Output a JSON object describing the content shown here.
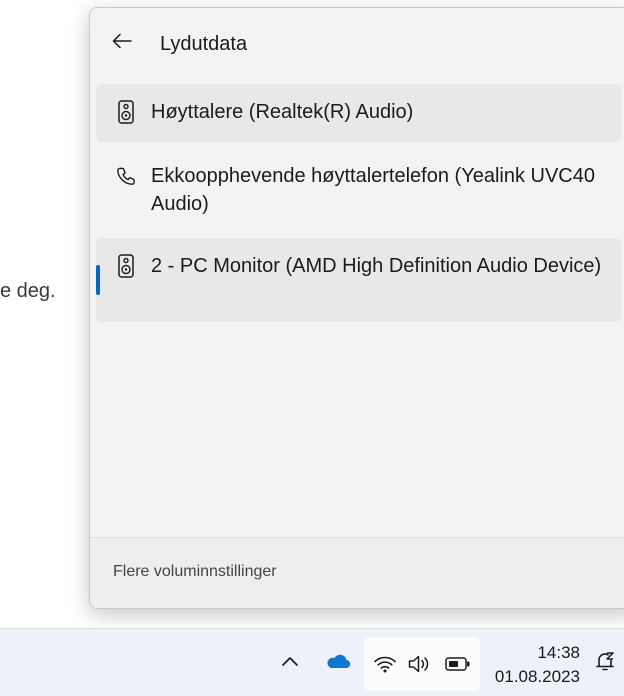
{
  "background": {
    "text": "e deg."
  },
  "flyout": {
    "title": "Lydutdata",
    "back_icon": "arrow-left-icon",
    "devices": [
      {
        "label": "Høyttalere (Realtek(R) Audio)",
        "icon": "speaker-icon",
        "highlighted": true,
        "selected": false
      },
      {
        "label": "Ekkoopphevende høyttalertelefon (Yealink UVC40 Audio)",
        "icon": "phone-icon",
        "highlighted": false,
        "selected": false
      },
      {
        "label": "2 - PC Monitor (AMD High Definition Audio Device)",
        "icon": "speaker-icon",
        "highlighted": true,
        "selected": true
      }
    ],
    "footer_link": "Flere voluminnstillinger"
  },
  "taskbar": {
    "clock_time": "14:38",
    "clock_date": "01.08.2023",
    "icons": [
      "chevron-up-icon",
      "onedrive-cloud-icon",
      "wifi-icon",
      "volume-icon",
      "battery-icon",
      "notification-bell-icon"
    ]
  },
  "colors": {
    "accent": "#0067c0",
    "onedrive": "#0f78d4"
  }
}
